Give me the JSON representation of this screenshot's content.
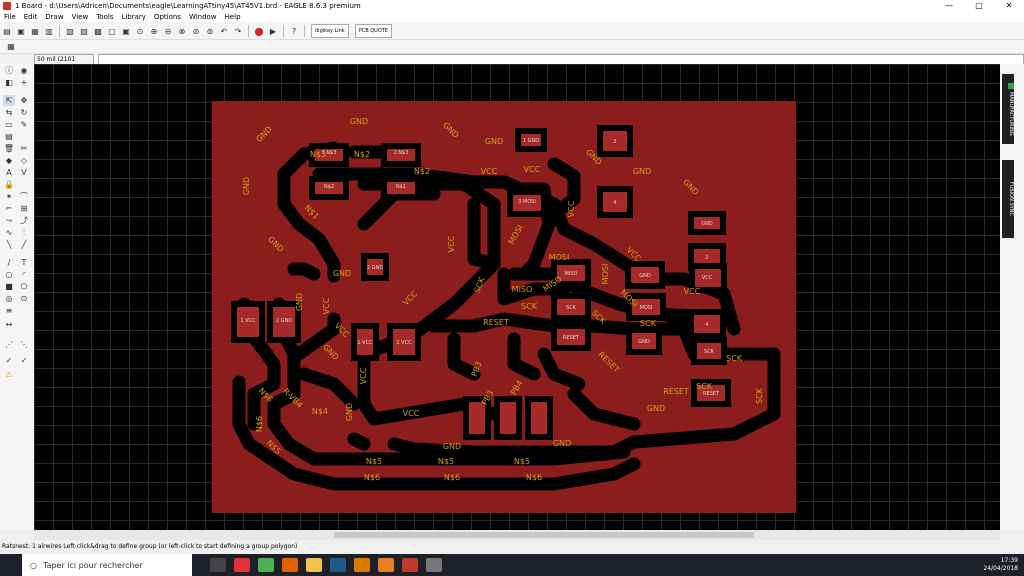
{
  "window": {
    "title": "1 Board - d:\\Users\\Adricen\\Documents\\eagle\\LearningATtiny45\\AT45V1.brd - EAGLE 8.6.3 premium",
    "minimize": "—",
    "maximize": "□",
    "close": "✕"
  },
  "menu": [
    "File",
    "Edit",
    "Draw",
    "View",
    "Tools",
    "Library",
    "Options",
    "Window",
    "Help"
  ],
  "toolbar": {
    "badge_digikey": "digikey\nLink",
    "badge_pcb": "PCB\nQUOTE"
  },
  "coord": {
    "value": "50 mil (2101 2262)"
  },
  "right_tabs": {
    "manufacturing": "MANUFACTURING",
    "fusion": "FUSION SYNC"
  },
  "status": {
    "text": "Ratsnest: 1 airwires Left-click&drag to define group (or left-click to start defining a group polygon)"
  },
  "taskbar": {
    "search_placeholder": "Taper ici pour rechercher",
    "time": "17:39",
    "date": "24/04/2018"
  },
  "colors": {
    "board": "#8b1d1d",
    "trace": "#b32626",
    "gap": "#000000",
    "label": "#d4a017"
  },
  "pcb": {
    "labels": [
      "GND",
      "GND",
      "GND",
      "GND",
      "GND",
      "GND",
      "GND",
      "GND",
      "GND",
      "GND",
      "GND",
      "GND",
      "GND",
      "GND",
      "GND",
      "GND",
      "VCC",
      "VCC",
      "VCC",
      "VCC",
      "VCC",
      "VCC",
      "VCC",
      "VCC",
      "VCC",
      "VCC",
      "VCC",
      "N$3",
      "N$2",
      "N$1",
      "N$2",
      "N$4",
      "N$5",
      "N$5",
      "N$5",
      "N$5",
      "N$6",
      "N$6",
      "N$6",
      "N$6",
      "N$6",
      "MOSI",
      "MOSI",
      "MOSI",
      "MOSI",
      "MISO",
      "MISO",
      "SCK",
      "SCK",
      "SCK",
      "SCK",
      "SCK",
      "SCK",
      "SCK",
      "RESET",
      "RESET",
      "RESET",
      "PB3",
      "PB3",
      "PB4",
      "R-VB4"
    ],
    "pads": [
      "1 GND",
      "2",
      "4",
      "GND",
      "2",
      "4",
      "1 N$3",
      "2 N$3",
      "N$2",
      "N$1",
      "3 MOSI",
      "2 GND",
      "1 VCC",
      "2 VCC",
      "MISO",
      "SCK",
      "MOSI",
      "RESET",
      "GND",
      "SCK",
      "RESET",
      "VCC",
      "GND",
      "1 VCC",
      "2 GND"
    ]
  }
}
